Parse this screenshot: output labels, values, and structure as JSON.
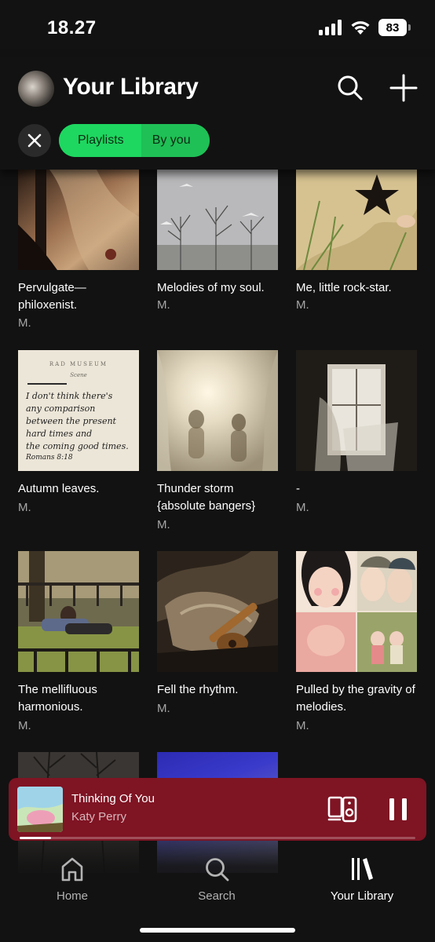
{
  "status": {
    "time": "18.27",
    "battery": "83"
  },
  "header": {
    "title": "Your Library"
  },
  "filters": {
    "playlists": "Playlists",
    "by_you": "By you"
  },
  "playlists": [
    {
      "title": "Pervulgate—philoxenist.",
      "owner": "M."
    },
    {
      "title": "Melodies of my soul.",
      "owner": "M."
    },
    {
      "title": "Me, little rock-star.",
      "owner": "M."
    },
    {
      "title": "Autumn leaves.",
      "owner": "M."
    },
    {
      "title": "Thunder storm {absolute bangers}",
      "owner": "M."
    },
    {
      "title": "-",
      "owner": "M."
    },
    {
      "title": "The mellifluous harmonious.",
      "owner": "M."
    },
    {
      "title": "Fell the rhythm.",
      "owner": "M."
    },
    {
      "title": "Pulled by the gravity of melodies.",
      "owner": "M."
    }
  ],
  "cover_texts": {
    "museum": "RAD MUSEUM",
    "scene": "Scene",
    "note_1": "I don't think there's",
    "note_2": "any comparison",
    "note_3": "between the present",
    "note_4": "hard times and",
    "note_5": "the coming good times.",
    "note_6": "Romans 8:18"
  },
  "now_playing": {
    "title": "Thinking Of You",
    "artist": "Katy Perry",
    "progress": 0.08
  },
  "nav": {
    "home": "Home",
    "search": "Search",
    "library": "Your Library"
  },
  "colors": {
    "accent": "#1ed760",
    "player_bg": "#7f1423",
    "background": "#121212"
  }
}
